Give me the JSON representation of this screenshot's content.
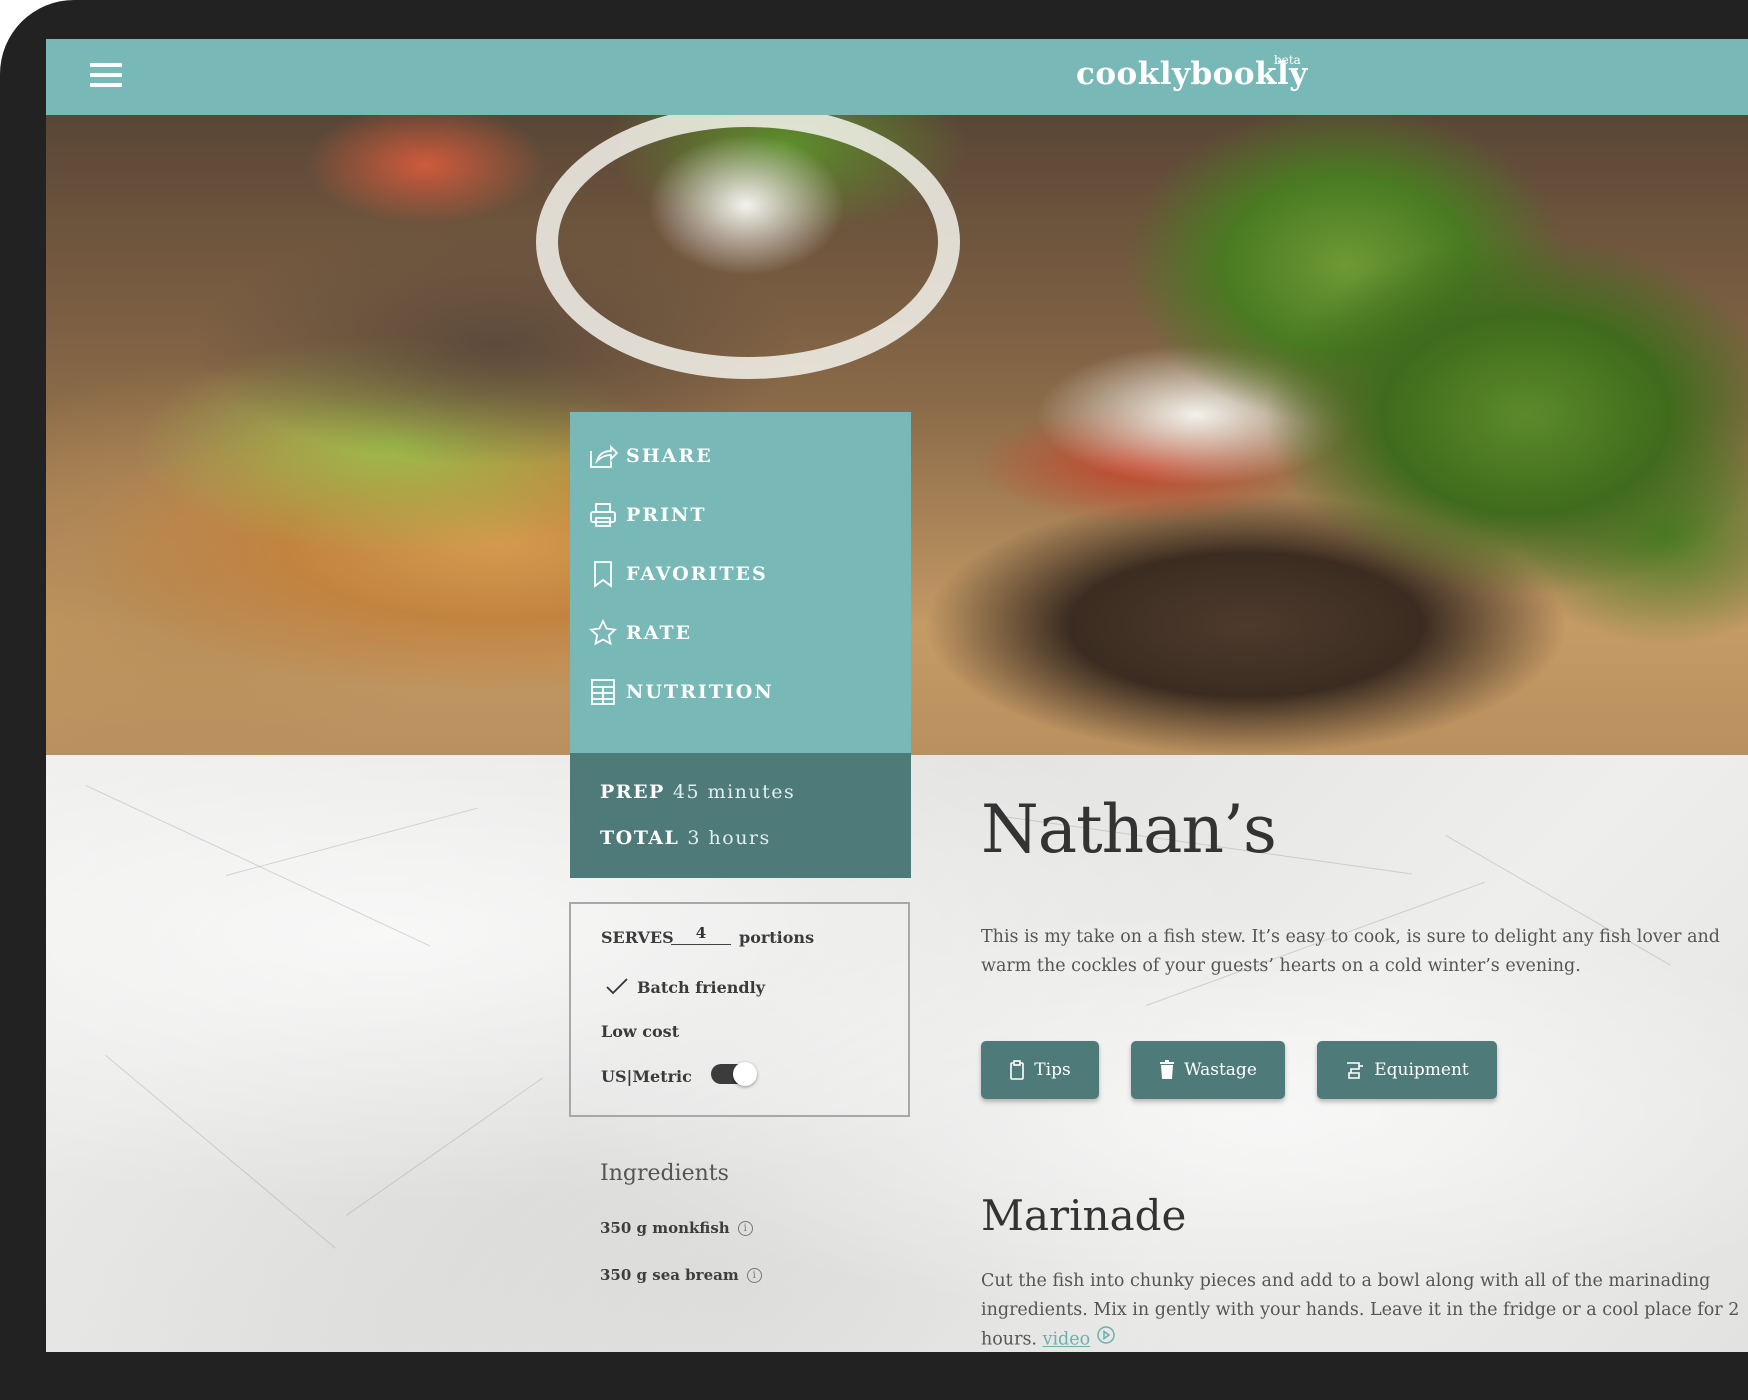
{
  "header": {
    "logo": "cooklybookly",
    "logo_badge": "beta",
    "menu_icon": "hamburger-menu-icon",
    "color": "#78b9b8"
  },
  "actions": [
    {
      "label": "SHARE",
      "icon": "share-icon"
    },
    {
      "label": "PRINT",
      "icon": "print-icon"
    },
    {
      "label": "FAVORITES",
      "icon": "bookmark-icon"
    },
    {
      "label": "RATE",
      "icon": "star-icon"
    },
    {
      "label": "NUTRITION",
      "icon": "nutrition-table-icon"
    }
  ],
  "times": {
    "prep_label": "PREP",
    "prep_value": "45 minutes",
    "total_label": "TOTAL",
    "total_value": "3 hours"
  },
  "info": {
    "serves_label": "SERVES",
    "serves_value": "4",
    "portions_label": "portions",
    "batch_label": "Batch friendly",
    "batch_icon": "check-icon",
    "cost_label": "Low cost",
    "units_label": "US|Metric",
    "units_toggle_on": true
  },
  "ingredients": {
    "title": "Ingredients",
    "items": [
      {
        "label": "350 g monkfish",
        "icon": "info-icon"
      },
      {
        "label": "350 g sea bream",
        "icon": "info-icon"
      }
    ]
  },
  "recipe": {
    "title": "Nathan’s",
    "description": "This is my take on a fish stew. It’s easy to cook, is sure to delight any fish lover and warm the cockles of your guests’ hearts on a cold winter’s evening.",
    "buttons": [
      {
        "label": "Tips",
        "icon": "clipboard-icon"
      },
      {
        "label": "Wastage",
        "icon": "trash-icon"
      },
      {
        "label": "Equipment",
        "icon": "mixer-icon"
      }
    ],
    "section_title": "Marinade",
    "section_text": "Cut the fish into chunky pieces and add to a bowl along with all of the marinading ingredients. Mix in gently with your hands. Leave it in the fridge or a cool place for 2 hours.",
    "video_label": "video",
    "video_icon": "play-circle-icon"
  },
  "colors": {
    "teal": "#78b9b8",
    "dark_teal": "#4e7a79",
    "text": "#333333"
  }
}
